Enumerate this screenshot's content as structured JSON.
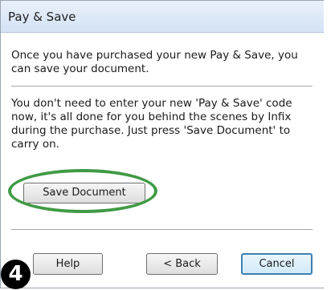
{
  "dialog": {
    "title": "Pay & Save",
    "intro_text": "Once you have purchased your new Pay & Save, you can save your document.",
    "info_text": "You don't need to enter your new 'Pay & Save' code now, it's all done for you behind the scenes by Infix during the purchase. Just press 'Save Document' to carry on.",
    "save_button_label": "Save Document"
  },
  "footer": {
    "help_label": "Help",
    "back_label": "< Back",
    "cancel_label": "Cancel"
  },
  "annotation": {
    "step_number": "4",
    "highlight_color": "#3f9a44"
  }
}
